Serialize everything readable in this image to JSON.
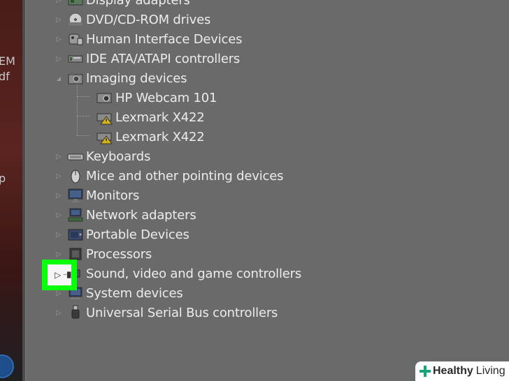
{
  "left_sidebar": {
    "fragments": [
      "EM",
      "df",
      "p"
    ]
  },
  "device_tree": {
    "categories": [
      {
        "label": "Display adapters",
        "icon": "display-adapter-icon",
        "expander": "▷"
      },
      {
        "label": "DVD/CD-ROM drives",
        "icon": "dvd-drive-icon",
        "expander": "▷"
      },
      {
        "label": "Human Interface Devices",
        "icon": "hid-icon",
        "expander": "▷"
      },
      {
        "label": "IDE ATA/ATAPI controllers",
        "icon": "ide-controller-icon",
        "expander": "▷"
      },
      {
        "label": "Imaging devices",
        "icon": "camera-icon",
        "expander": "◢",
        "expanded": true,
        "children": [
          {
            "label": "HP Webcam 101",
            "icon": "webcam-icon"
          },
          {
            "label": "Lexmark X422",
            "icon": "scanner-warning-icon"
          },
          {
            "label": "Lexmark X422",
            "icon": "scanner-warning-icon"
          }
        ]
      },
      {
        "label": "Keyboards",
        "icon": "keyboard-icon",
        "expander": "▷"
      },
      {
        "label": "Mice and other pointing devices",
        "icon": "mouse-icon",
        "expander": "▷"
      },
      {
        "label": "Monitors",
        "icon": "monitor-icon",
        "expander": "▷"
      },
      {
        "label": "Network adapters",
        "icon": "network-adapter-icon",
        "expander": "▷"
      },
      {
        "label": "Portable Devices",
        "icon": "portable-device-icon",
        "expander": "▷"
      },
      {
        "label": "Processors",
        "icon": "processor-icon",
        "expander": "▷"
      },
      {
        "label": "Sound, video and game controllers",
        "icon": "sound-icon",
        "expander": "▷"
      },
      {
        "label": "System devices",
        "icon": "system-device-icon",
        "expander": "▷"
      },
      {
        "label": "Universal Serial Bus controllers",
        "icon": "usb-icon",
        "expander": "▷"
      }
    ]
  },
  "highlight": {
    "color": "#0aff0a",
    "expander": "▷",
    "dots": "··"
  },
  "watermark": {
    "brand": "Healthy",
    "brand2": "Living",
    "accent": "#1aa37a"
  }
}
